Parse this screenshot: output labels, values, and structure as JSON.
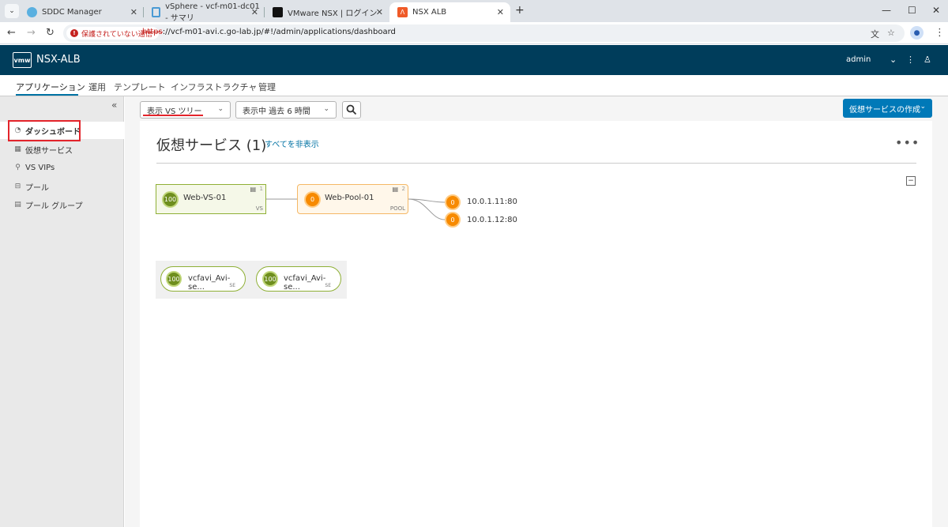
{
  "browser": {
    "tabs": [
      {
        "title": "SDDC Manager"
      },
      {
        "title": "vSphere - vcf-m01-dc01 - サマリ"
      },
      {
        "title": "VMware NSX | ログイン"
      },
      {
        "title": "NSX ALB"
      }
    ],
    "security_chip": "保護されていない通信",
    "url_scheme": "https",
    "url_rest": "://vcf-m01-avi.c.go-lab.jp/#!/admin/applications/dashboard",
    "new_tab_symbol": "+",
    "colors": {
      "tab_bar": "#dfe3e8",
      "insecure": "#c5221f"
    }
  },
  "app": {
    "logo": "vmw",
    "name": "NSX-ALB",
    "user": "admin",
    "header_color": "#003d5b"
  },
  "nav": {
    "tabs": [
      "アプリケーション",
      "運用",
      "テンプレート",
      "インフラストラクチャ",
      "管理"
    ],
    "active": "アプリケーション"
  },
  "sidebar": {
    "collapse_symbol": "«",
    "items": [
      {
        "label": "ダッシュボード",
        "icon": "dashboard-icon"
      },
      {
        "label": "仮想サービス",
        "icon": "virtual-service-icon"
      },
      {
        "label": "VS VIPs",
        "icon": "location-pin-icon"
      },
      {
        "label": "プール",
        "icon": "pool-icon"
      },
      {
        "label": "プール グループ",
        "icon": "pool-group-icon"
      }
    ],
    "active": "ダッシュボード"
  },
  "toolbar": {
    "view_select": "表示 VS ツリー",
    "time_select": "表示中 過去 6 時間",
    "create_button": "仮想サービスの作成"
  },
  "dashboard": {
    "title": "仮想サービス",
    "count": "(1)",
    "hide_all": "すべてを非表示",
    "more_symbol": "•••",
    "collapse_symbol": "−",
    "tree": {
      "vs": {
        "name": "Web-VS-01",
        "score": "100",
        "kind": "VS",
        "count": "1"
      },
      "pool": {
        "name": "Web-Pool-01",
        "score": "0",
        "kind": "POOL",
        "count": "2"
      },
      "servers": [
        {
          "ip": "10.0.1.11:80",
          "score": "0"
        },
        {
          "ip": "10.0.1.12:80",
          "score": "0"
        }
      ]
    },
    "service_engines": [
      {
        "name": "vcfavi_Avi-se...",
        "score": "100",
        "kind": "SE"
      },
      {
        "name": "vcfavi_Avi-se...",
        "score": "100",
        "kind": "SE"
      }
    ],
    "colors": {
      "healthy": "#6e8e1e",
      "warning": "#f78a00",
      "vs_fill": "#f5f8e8",
      "pool_fill": "#fff7ea"
    }
  }
}
